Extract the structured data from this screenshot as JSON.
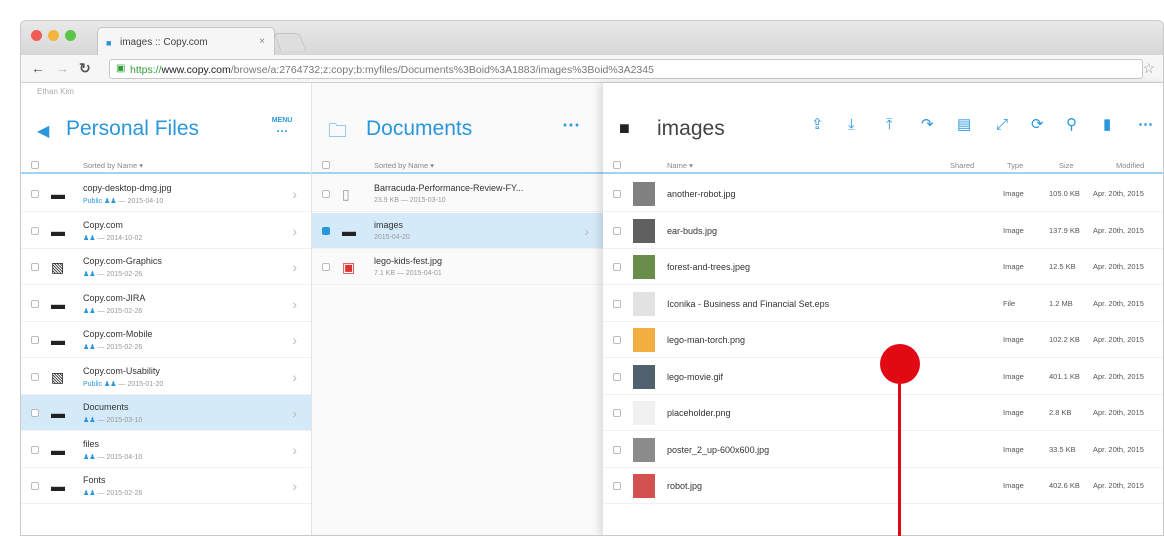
{
  "browser": {
    "tab_title": "images :: Copy.com",
    "url_protocol": "https://",
    "url_host": "www.copy.com",
    "url_path": "/browse/a:2764732;z:copy;b:myfiles/Documents%3Boid%3A1883/images%3Boid%3A2345",
    "colors": {
      "red": "#ee5c54",
      "yellow": "#f3b43a",
      "green": "#5cc549"
    }
  },
  "user_name": "Ethan Kim",
  "accent_color": "#2a97dc",
  "pane1": {
    "title": "Personal Files",
    "menu_label": "MENU",
    "sort_label": "Sorted by Name",
    "rows": [
      {
        "name": "copy-desktop-dmg.jpg",
        "meta": "2015-04-10",
        "public": "Public",
        "icon": "folder-icon"
      },
      {
        "name": "Copy.com",
        "meta": "2014-10-02",
        "public": "",
        "icon": "folder-icon"
      },
      {
        "name": "Copy.com-Graphics",
        "meta": "2015-02-26",
        "public": "",
        "icon": "shared-folder-icon"
      },
      {
        "name": "Copy.com-JIRA",
        "meta": "2015-02-26",
        "public": "",
        "icon": "folder-icon"
      },
      {
        "name": "Copy.com-Mobile",
        "meta": "2015-02-26",
        "public": "",
        "icon": "folder-icon"
      },
      {
        "name": "Copy.com-Usability",
        "meta": "2015-01-20",
        "public": "Public",
        "icon": "shared-folder-icon"
      },
      {
        "name": "Documents",
        "meta": "2015-03-10",
        "public": "",
        "icon": "folder-icon",
        "selected": true
      },
      {
        "name": "files",
        "meta": "2015-04-10",
        "public": "",
        "icon": "folder-icon"
      },
      {
        "name": "Fonts",
        "meta": "2015-02-26",
        "public": "",
        "icon": "folder-icon"
      }
    ]
  },
  "pane2": {
    "title": "Documents",
    "sort_label": "Sorted by Name",
    "rows": [
      {
        "name": "Barracuda-Performance-Review-FY...",
        "meta": "23.9 KB — 2015-03-10",
        "icon": "document-icon"
      },
      {
        "name": "images",
        "meta": "2015-04-20",
        "icon": "folder-icon",
        "selected": true
      },
      {
        "name": "lego-kids-fest.jpg",
        "meta": "7.1 KB — 2015-04-01",
        "icon": "image-thumbnail-icon"
      }
    ]
  },
  "pane3": {
    "title": "images",
    "columns": {
      "name": "Name",
      "shared": "Shared",
      "type": "Type",
      "size": "Size",
      "modified": "Modified"
    },
    "toolbar_icons": [
      "share-icon",
      "download-icon",
      "upload-icon",
      "move-icon",
      "new-folder-icon",
      "expand-icon",
      "sync-icon",
      "search-icon",
      "trash-icon",
      "more-icon"
    ],
    "rows": [
      {
        "name": "another-robot.jpg",
        "type": "Image",
        "size": "105.0 KB",
        "modified": "Apr. 20th, 2015"
      },
      {
        "name": "ear-buds.jpg",
        "type": "Image",
        "size": "137.9 KB",
        "modified": "Apr. 20th, 2015"
      },
      {
        "name": "forest-and-trees.jpeg",
        "type": "Image",
        "size": "12.5 KB",
        "modified": "Apr. 20th, 2015"
      },
      {
        "name": "Iconika - Business and Financial Set.eps",
        "type": "File",
        "size": "1.2 MB",
        "modified": "Apr. 20th, 2015"
      },
      {
        "name": "lego-man-torch.png",
        "type": "Image",
        "size": "102.2 KB",
        "modified": "Apr. 20th, 2015"
      },
      {
        "name": "lego-movie.gif",
        "type": "Image",
        "size": "401.1 KB",
        "modified": "Apr. 20th, 2015"
      },
      {
        "name": "placeholder.png",
        "type": "Image",
        "size": "2.8 KB",
        "modified": "Apr. 20th, 2015"
      },
      {
        "name": "poster_2_up-600x600.jpg",
        "type": "Image",
        "size": "33.5 KB",
        "modified": "Apr. 20th, 2015"
      },
      {
        "name": "robot.jpg",
        "type": "Image",
        "size": "402.6 KB",
        "modified": "Apr. 20th, 2015"
      }
    ]
  },
  "pointer_color": "#e10a14"
}
